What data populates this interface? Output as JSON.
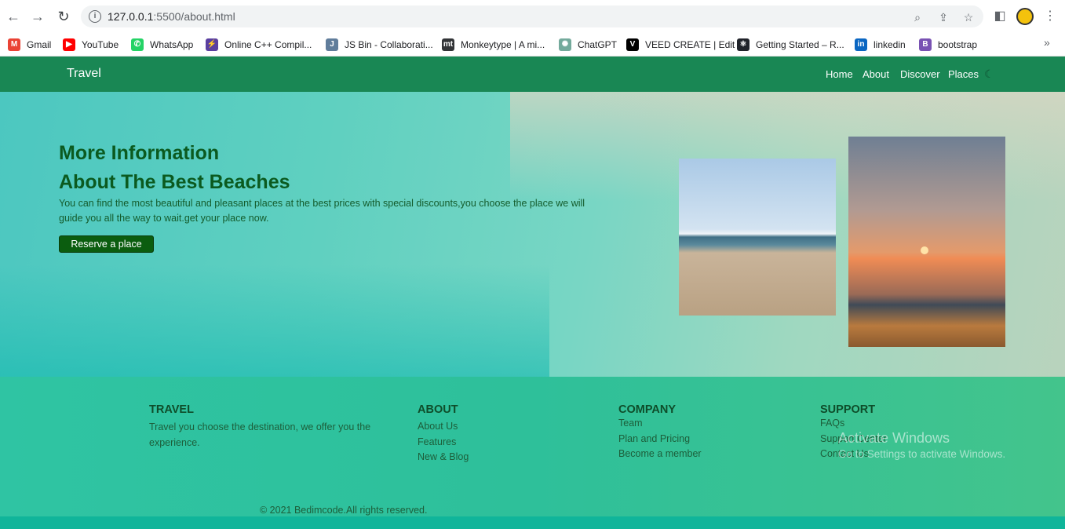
{
  "browser": {
    "url_host": "127.0.0.1",
    "url_rest": ":5500/about.html",
    "bookmarks": [
      {
        "label": "Gmail",
        "icon": "gmail-icon",
        "color": "#ea4335",
        "glyph": "M"
      },
      {
        "label": "YouTube",
        "icon": "youtube-icon",
        "color": "#ff0000",
        "glyph": "▶"
      },
      {
        "label": "WhatsApp",
        "icon": "whatsapp-icon",
        "color": "#25d366",
        "glyph": "✆"
      },
      {
        "label": "Online C++ Compil...",
        "icon": "bolt-icon",
        "color": "#5a3fa0",
        "glyph": "⚡"
      },
      {
        "label": "JS Bin - Collaborati...",
        "icon": "jsbin-icon",
        "color": "#607d9b",
        "glyph": "J"
      },
      {
        "label": "Monkeytype | A mi...",
        "icon": "monkeytype-icon",
        "color": "#323437",
        "glyph": "mt"
      },
      {
        "label": "ChatGPT",
        "icon": "chatgpt-icon",
        "color": "#74aa9c",
        "glyph": "✺"
      },
      {
        "label": "VEED CREATE | Edit",
        "icon": "veed-icon",
        "color": "#000000",
        "glyph": "V"
      },
      {
        "label": "Getting Started – R...",
        "icon": "react-icon",
        "color": "#20232a",
        "glyph": "⚛"
      },
      {
        "label": "linkedin",
        "icon": "linkedin-icon",
        "color": "#0a66c2",
        "glyph": "in"
      },
      {
        "label": "bootstrap",
        "icon": "bootstrap-icon",
        "color": "#7952b3",
        "glyph": "B"
      }
    ]
  },
  "site": {
    "brand": "Travel",
    "nav": [
      "Home",
      "About",
      "Discover",
      "Places"
    ],
    "hero": {
      "title_line1": "More Information",
      "title_line2": "About The Best Beaches",
      "paragraph": "You can find the most beautiful and pleasant places at the best prices with special discounts,you choose the place we will guide you all the way to wait.get your place now.",
      "button": "Reserve a place"
    },
    "footer": {
      "travel": {
        "heading": "TRAVEL",
        "text": "Travel you choose the destination, we offer you the experience."
      },
      "about": {
        "heading": "ABOUT",
        "items": [
          "About Us",
          "Features",
          "New & Blog"
        ]
      },
      "company": {
        "heading": "COMPANY",
        "items": [
          "Team",
          "Plan and Pricing",
          "Become a member"
        ]
      },
      "support": {
        "heading": "SUPPORT",
        "items": [
          "FAQs",
          "Support Center",
          "Contact Us"
        ]
      },
      "copyright": "© 2021 Bedimcode.All rights reserved."
    }
  },
  "watermark": {
    "line1": "Activate Windows",
    "line2": "Go to Settings to activate Windows."
  }
}
